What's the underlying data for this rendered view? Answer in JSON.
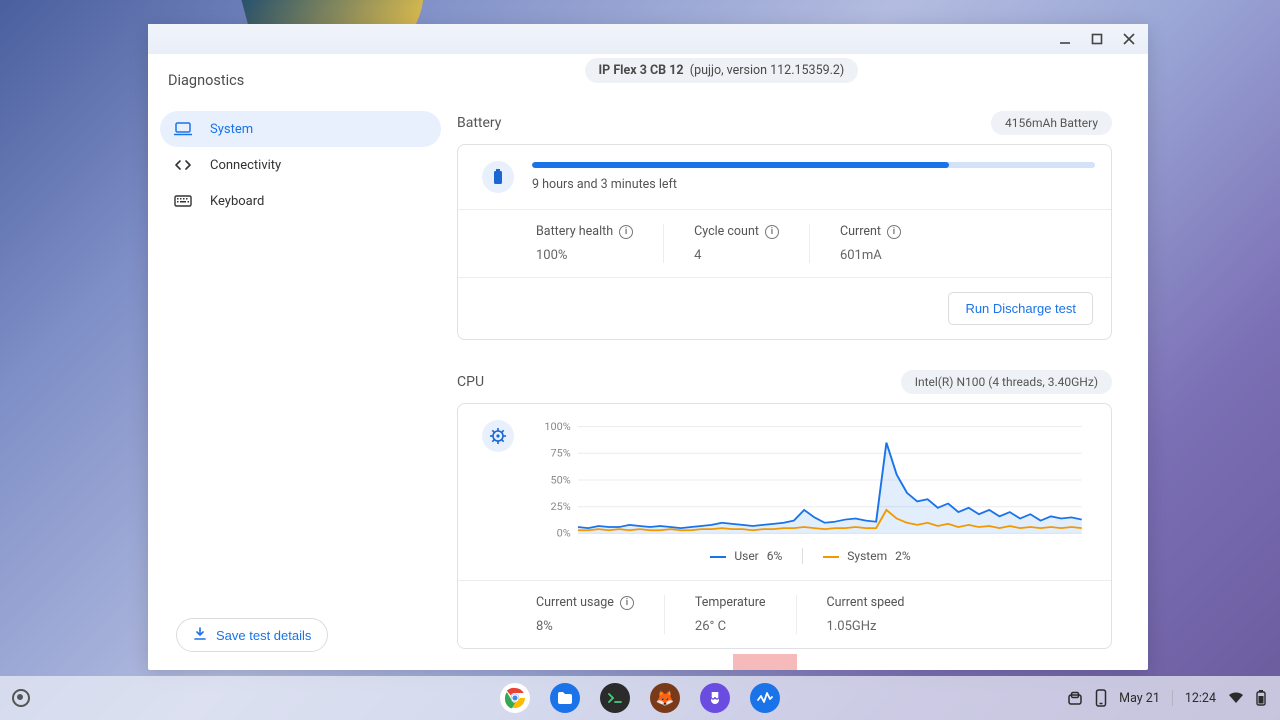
{
  "window": {
    "title": "Diagnostics",
    "minimize_tip": "Minimize",
    "maximize_tip": "Maximize",
    "close_tip": "Close"
  },
  "sidebar": {
    "items": [
      {
        "label": "System",
        "icon": "laptop-icon",
        "active": true
      },
      {
        "label": "Connectivity",
        "icon": "network-icon",
        "active": false
      },
      {
        "label": "Keyboard",
        "icon": "keyboard-icon",
        "active": false
      }
    ],
    "save_label": "Save test details"
  },
  "device": {
    "model": "IP Flex 3 CB 12",
    "codename_version": "(pujjo, version 112.15359.2)"
  },
  "battery": {
    "section_title": "Battery",
    "chip": "4156mAh Battery",
    "percent": 74,
    "time_remaining": "9 hours and 3 minutes left",
    "stats": {
      "health_label": "Battery health",
      "health_value": "100%",
      "cycle_label": "Cycle count",
      "cycle_value": "4",
      "current_label": "Current",
      "current_value": "601mA"
    },
    "run_button": "Run Discharge test"
  },
  "cpu": {
    "section_title": "CPU",
    "chip": "Intel(R) N100 (4 threads, 3.40GHz)",
    "legend": {
      "user_label": "User",
      "user_value": "6%",
      "system_label": "System",
      "system_value": "2%"
    },
    "stats": {
      "usage_label": "Current usage",
      "usage_value": "8%",
      "temp_label": "Temperature",
      "temp_value": "26° C",
      "speed_label": "Current speed",
      "speed_value": "1.05GHz"
    }
  },
  "chart_data": {
    "type": "line",
    "ylabel": "",
    "xlabel": "",
    "ylim": [
      0,
      100
    ],
    "y_ticks": [
      "100%",
      "75%",
      "50%",
      "25%",
      "0%"
    ],
    "series": [
      {
        "name": "User",
        "color": "#1a73e8",
        "values": [
          6,
          5,
          7,
          6,
          6,
          8,
          7,
          6,
          7,
          6,
          5,
          6,
          7,
          8,
          10,
          9,
          8,
          7,
          8,
          9,
          10,
          12,
          22,
          15,
          10,
          11,
          13,
          14,
          12,
          11,
          85,
          55,
          38,
          30,
          32,
          24,
          28,
          20,
          24,
          18,
          22,
          16,
          20,
          14,
          18,
          12,
          16,
          14,
          15,
          13
        ]
      },
      {
        "name": "System",
        "color": "#f29900",
        "values": [
          3,
          3,
          4,
          3,
          4,
          3,
          4,
          3,
          3,
          4,
          3,
          3,
          4,
          4,
          5,
          4,
          4,
          3,
          4,
          4,
          5,
          5,
          6,
          5,
          4,
          5,
          5,
          6,
          5,
          5,
          22,
          14,
          10,
          8,
          10,
          7,
          9,
          6,
          8,
          6,
          7,
          5,
          7,
          5,
          6,
          5,
          6,
          5,
          6,
          5
        ]
      }
    ]
  },
  "shelf": {
    "apps": [
      {
        "name": "chrome",
        "color": "#fff"
      },
      {
        "name": "files",
        "color": "#1a73e8"
      },
      {
        "name": "terminal",
        "color": "#2b2b2b"
      },
      {
        "name": "app-a",
        "color": "#7a3a1a"
      },
      {
        "name": "app-b",
        "color": "#6a4de0"
      },
      {
        "name": "diagnostics",
        "color": "#1a73e8"
      }
    ],
    "date": "May 21",
    "time": "12:24"
  }
}
